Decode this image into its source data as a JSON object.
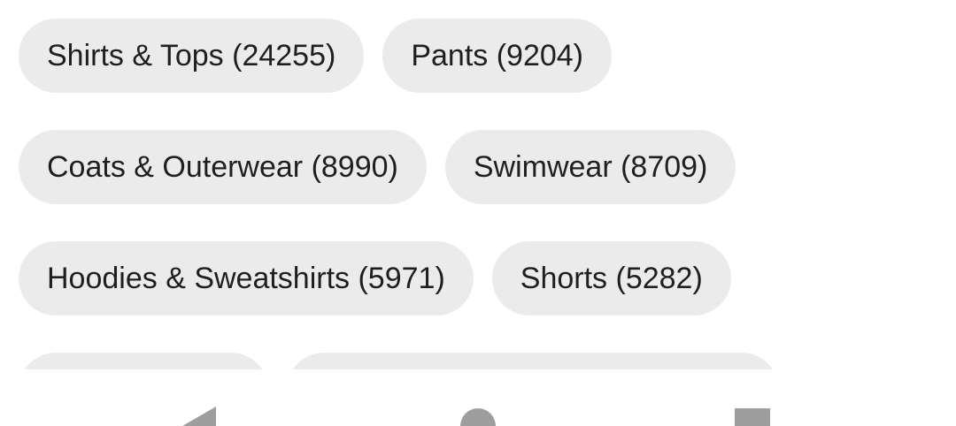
{
  "chips": {
    "row1": [
      {
        "label": "Shirts & Tops (24255)"
      },
      {
        "label": "Pants (9204)"
      }
    ],
    "row2": [
      {
        "label": "Coats & Outerwear (8990)"
      },
      {
        "label": "Swimwear (8709)"
      }
    ],
    "row3": [
      {
        "label": "Hoodies & Sweatshirts (5971)"
      },
      {
        "label": "Shorts (5282)"
      }
    ]
  },
  "nav": {
    "back_icon": "back-triangle-icon",
    "home_icon": "home-circle-icon",
    "recents_icon": "recents-square-icon",
    "icon_color": "#9e9e9e"
  },
  "colors": {
    "chip_background": "#ebebeb",
    "chip_text": "#1f1f1f",
    "page_background": "#ffffff"
  }
}
